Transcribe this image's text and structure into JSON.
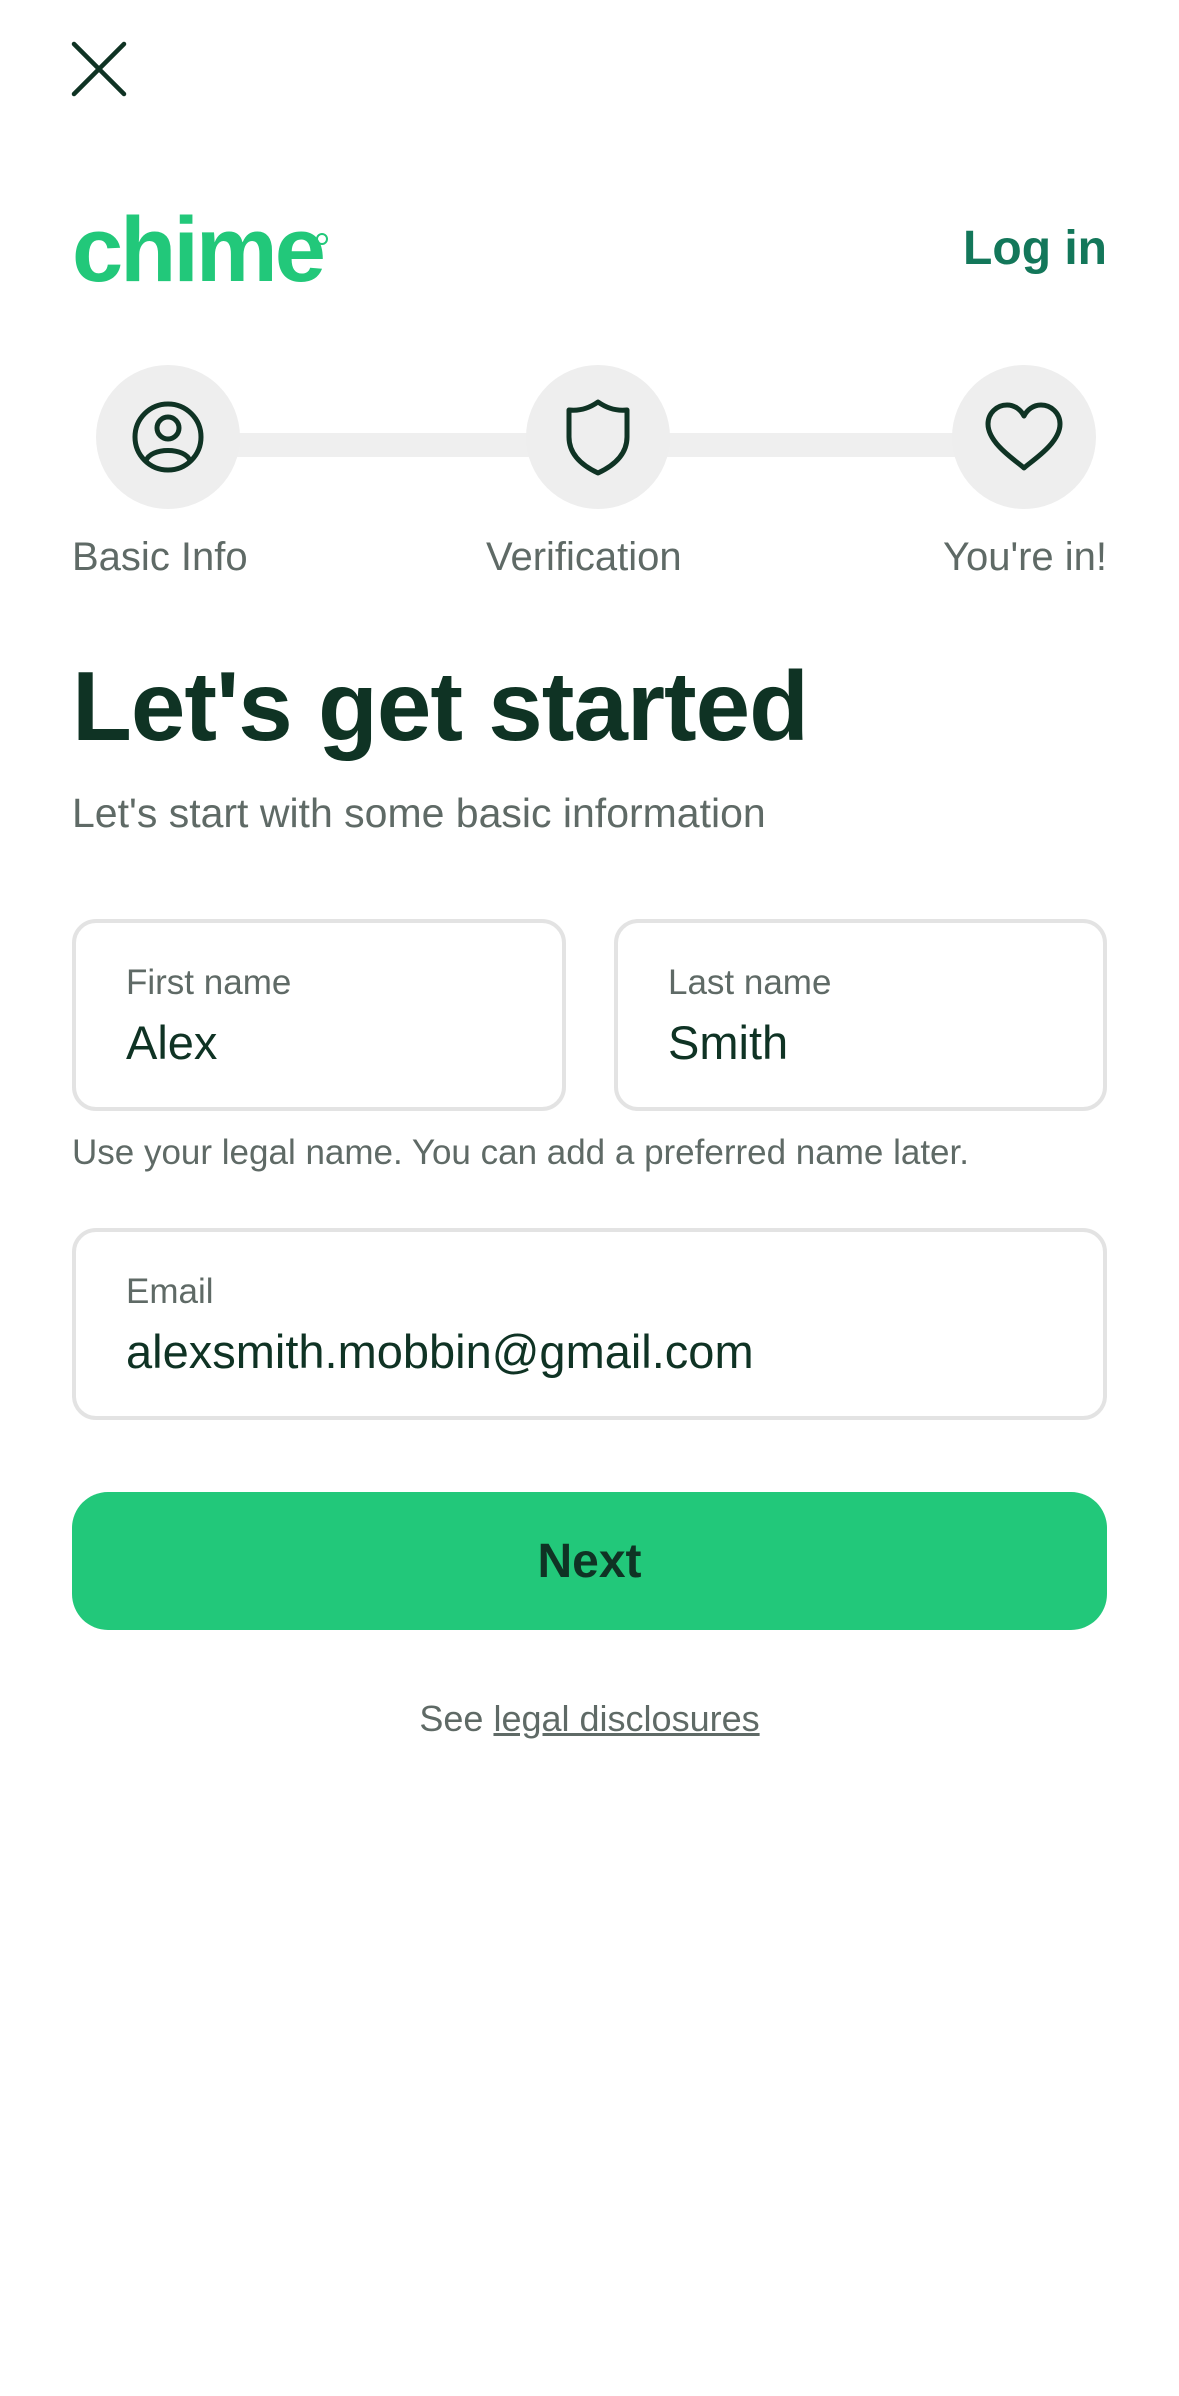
{
  "header": {
    "logo_text": "chime",
    "login_label": "Log in"
  },
  "colors": {
    "brand_green": "#22c87a",
    "dark_green": "#0f3324",
    "link_green": "#13775a"
  },
  "stepper": {
    "steps": [
      {
        "label": "Basic Info",
        "icon": "user-circle-icon"
      },
      {
        "label": "Verification",
        "icon": "shield-icon"
      },
      {
        "label": "You're in!",
        "icon": "heart-icon"
      }
    ]
  },
  "main": {
    "title": "Let's get started",
    "subtitle": "Let's start with some basic information"
  },
  "form": {
    "first_name": {
      "label": "First name",
      "value": "Alex"
    },
    "last_name": {
      "label": "Last name",
      "value": "Smith"
    },
    "name_helper": "Use your legal name. You can add a preferred name later.",
    "email": {
      "label": "Email",
      "value": "alexsmith.mobbin@gmail.com"
    },
    "next_label": "Next"
  },
  "footer": {
    "prefix": "See",
    "link_label": "legal disclosures"
  }
}
